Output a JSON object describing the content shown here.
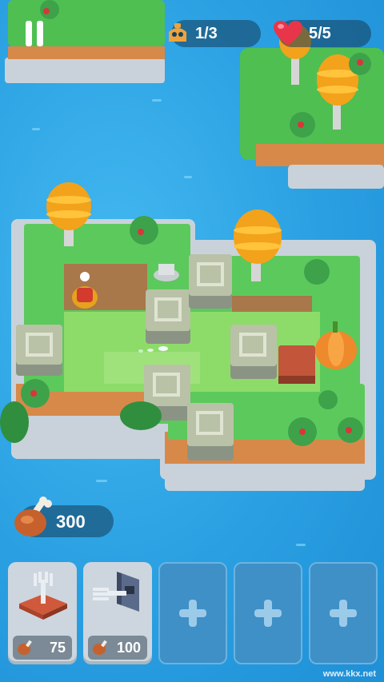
{
  "hud": {
    "pause_label": "Pause",
    "enemy_counter": "1/3",
    "lives_counter": "5/5"
  },
  "resources": {
    "food_amount": "300"
  },
  "cards": [
    {
      "kind": "fork-trap",
      "cost": "75"
    },
    {
      "kind": "wall-fork-trap",
      "cost": "100"
    },
    {
      "kind": "empty-slot"
    },
    {
      "kind": "empty-slot"
    },
    {
      "kind": "empty-slot"
    }
  ],
  "watermark": "www.kkx.net",
  "colors": {
    "sea": "#2fa6e6",
    "grass": "#5cc95c",
    "dirt": "#a8774a",
    "stone_block": "#b9c2a7",
    "hud_pill": "#14405a",
    "heart": "#e8354a"
  }
}
